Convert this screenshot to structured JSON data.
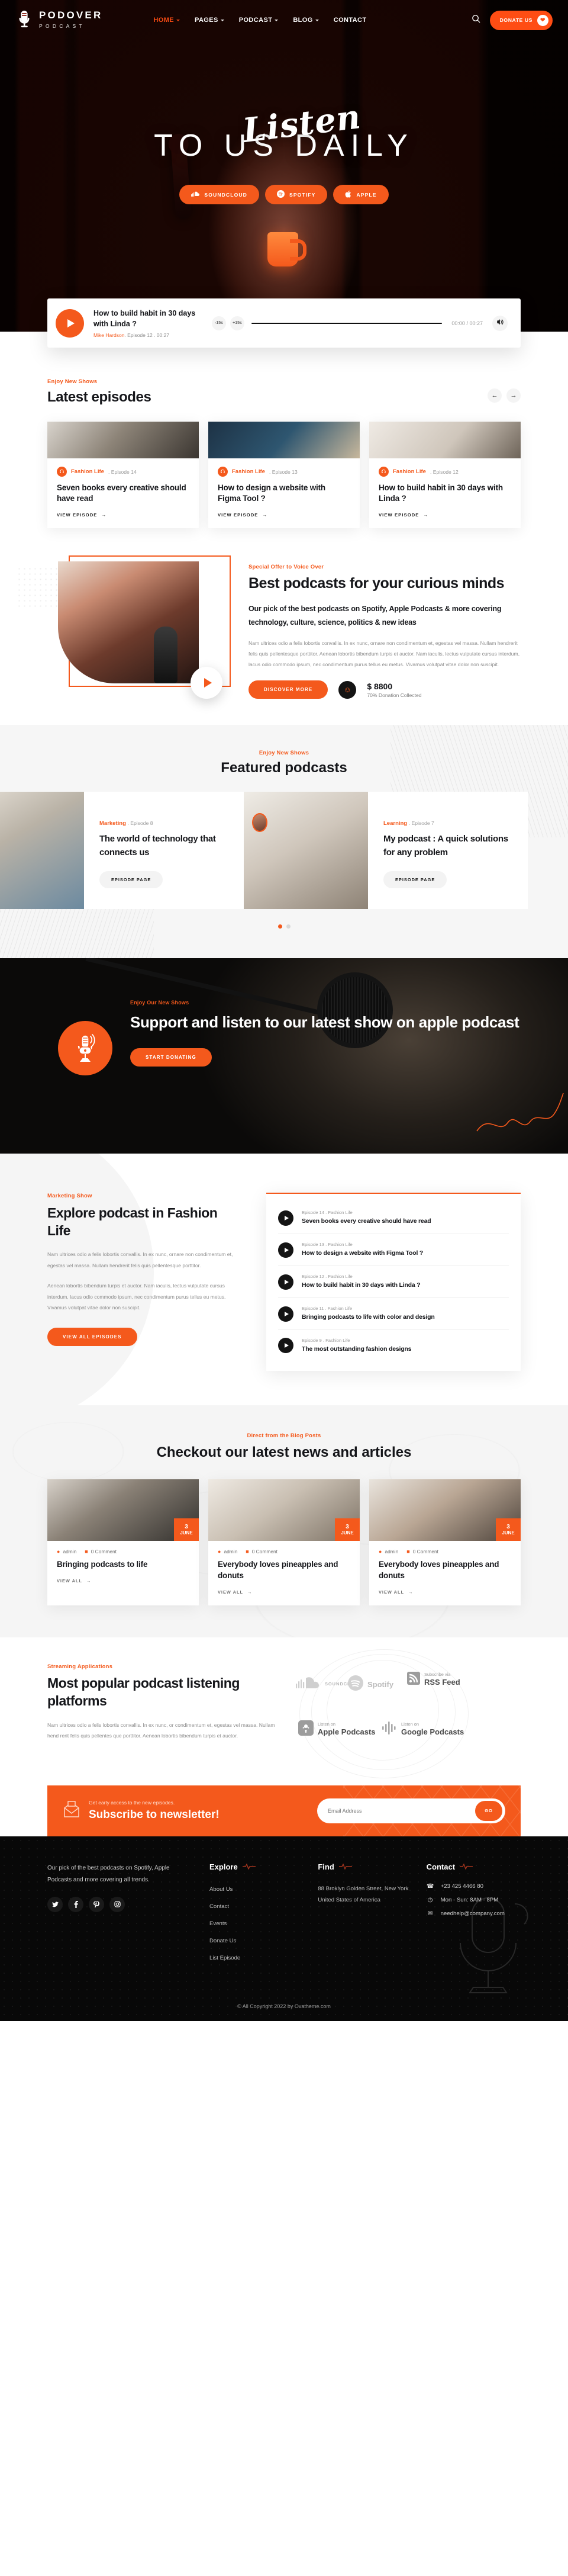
{
  "brand": {
    "name": "PODOVER",
    "tagline": "PODCAST",
    "logo_icon": "microphone-icon"
  },
  "nav": {
    "items": [
      {
        "label": "HOME",
        "has_caret": true,
        "active": true
      },
      {
        "label": "PAGES",
        "has_caret": true,
        "active": false
      },
      {
        "label": "PODCAST",
        "has_caret": true,
        "active": false
      },
      {
        "label": "BLOG",
        "has_caret": true,
        "active": false
      },
      {
        "label": "CONTACT",
        "has_caret": false,
        "active": false
      }
    ],
    "search_icon": "search-icon",
    "donate_label": "DONATE US",
    "donate_icon": "heart-icon"
  },
  "hero": {
    "script_word": "Listen",
    "headline": "TO US DAILY",
    "buttons": [
      {
        "label": "SOUNDCLOUD",
        "icon": "soundcloud-icon"
      },
      {
        "label": "SPOTIFY",
        "icon": "spotify-icon"
      },
      {
        "label": "APPLE",
        "icon": "apple-icon"
      }
    ]
  },
  "player": {
    "title": "How to build habit in 30 days with Linda ?",
    "author": "Mike Hardson",
    "meta": ". Episode 12 . 00:27",
    "back_label": "-15s",
    "forward_label": "+15s",
    "current_time": "00:00",
    "separator": "/",
    "duration": "00:27",
    "play_icon": "play-icon",
    "volume_icon": "volume-icon"
  },
  "latest": {
    "eyebrow": "Enjoy New Shows",
    "title": "Latest episodes",
    "prev_icon": "arrow-left-icon",
    "next_icon": "arrow-right-icon",
    "link_label": "VIEW EPISODE",
    "cards": [
      {
        "category": "Fashion Life",
        "episode": ". Episode 14",
        "title": "Seven books every creative should have read"
      },
      {
        "category": "Fashion Life",
        "episode": ". Episode 13",
        "title": "How to design a website with Figma Tool ?"
      },
      {
        "category": "Fashion Life",
        "episode": ". Episode 12",
        "title": "How to build habit in 30 days with Linda ?"
      }
    ]
  },
  "best": {
    "eyebrow": "Special Offer to Voice Over",
    "title": "Best podcasts for your curious minds",
    "lead": "Our pick of the best podcasts on Spotify, Apple Podcasts & more covering technology, culture, science, politics & new ideas",
    "paragraph": "Nam ultrices odio a felis lobortis convallis. In ex nunc, ornare non condimentum et, egestas vel massa. Nullam hendrerit felis quis pellentesque porttitor. Aenean lobortis bibendum turpis et auctor. Nam iaculis, lectus vulputate cursus interdum, lacus odio commodo ipsum, nec condimentum purus tellus eu metus. Vivamus volutpat vitae dolor non suscipit.",
    "cta_label": "DISCOVER MORE",
    "donation_amount": "$ 8800",
    "donation_sub": "70% Donation Collected",
    "play_icon": "play-icon",
    "donation_icon": "donation-hand-icon"
  },
  "featured": {
    "eyebrow": "Enjoy New Shows",
    "title": "Featured podcasts",
    "button_label": "EPISODE PAGE",
    "cards": [
      {
        "category": "Marketing",
        "episode": ". Episode 8",
        "title": "The world of technology that connects us"
      },
      {
        "category": "Learning",
        "episode": ". Episode 7",
        "title": "My podcast : A quick solutions for any problem"
      }
    ],
    "pager": {
      "active_index": 0,
      "count": 2
    }
  },
  "support": {
    "eyebrow": "Enjoy Our New Shows",
    "title": "Support and listen to our latest show on apple podcast",
    "cta_label": "START DONATING",
    "icon": "microphone-icon"
  },
  "explore": {
    "eyebrow": "Marketing Show",
    "title": "Explore podcast in Fashion Life",
    "paragraph1": "Nam ultrices odio a felis lobortis convallis. In ex nunc, ornare non condimentum et, egestas vel massa. Nullam hendrerit felis quis pellentesque porttitor.",
    "paragraph2": "Aenean lobortis bibendum turpis et auctor. Nam iaculis, lectus vulputate cursus interdum, lacus odio commodo ipsum, nec condimentum purus tellus eu metus. Vivamus volutpat vitae dolor non suscipit.",
    "cta_label": "VIEW ALL EPISODES",
    "episodes": [
      {
        "meta": "Episode 14 . Fashion Life",
        "title": "Seven books every creative should have read"
      },
      {
        "meta": "Episode 13 . Fashion Life",
        "title": "How to design a website with Figma Tool ?"
      },
      {
        "meta": "Episode 12 . Fashion Life",
        "title": "How to build habit in 30 days with Linda ?"
      },
      {
        "meta": "Episode 11 . Fashion Life",
        "title": "Bringing podcasts to life with color and design"
      },
      {
        "meta": "Episode 9 . Fashion Life",
        "title": "The most outstanding fashion designs"
      }
    ]
  },
  "blog": {
    "eyebrow": "Direct from the Blog Posts",
    "title": "Checkout our latest news and articles",
    "link_label": "VIEW ALL",
    "posts": [
      {
        "day": "3",
        "month": "JUNE",
        "author": "admin",
        "comments": "0 Comment",
        "title": "Bringing podcasts to life"
      },
      {
        "day": "3",
        "month": "JUNE",
        "author": "admin",
        "comments": "0 Comment",
        "title": "Everybody loves pineapples and donuts"
      },
      {
        "day": "3",
        "month": "JUNE",
        "author": "admin",
        "comments": "0 Comment",
        "title": "Everybody loves pineapples and donuts"
      }
    ]
  },
  "platforms": {
    "eyebrow": "Streaming Applications",
    "title": "Most popular podcast listening platforms",
    "paragraph": "Nam ultrices odio a felis lobortis convallis. In ex nunc, or condimentum et, egestas vel massa. Nullam hend rerit felis quis pellentes que porttitor. Aenean lobortis bibendum turpis et auctor.",
    "logos": [
      {
        "sub": "",
        "main": "SOUNDCLOUD",
        "icon": "soundcloud-icon"
      },
      {
        "sub": "",
        "main": "Spotify",
        "icon": "spotify-icon"
      },
      {
        "sub": "Subscribe via",
        "main": "RSS Feed",
        "icon": "rss-icon"
      },
      {
        "sub": "Listen on",
        "main": "Apple Podcasts",
        "icon": "apple-podcasts-icon"
      },
      {
        "sub": "Listen on",
        "main": "Google Podcasts",
        "icon": "google-podcasts-icon"
      }
    ]
  },
  "newsletter": {
    "small": "Get early access to the new episodes.",
    "title": "Subscribe to newsletter!",
    "placeholder": "Email Address",
    "value": "",
    "button_label": "GO",
    "icon": "envelope-icon"
  },
  "footer": {
    "about": "Our pick of the best podcasts on Spotify, Apple Podcasts and more covering all trends.",
    "socials": [
      {
        "name": "twitter-icon",
        "glyph": "ᵗ"
      },
      {
        "name": "facebook-icon",
        "glyph": "f"
      },
      {
        "name": "pinterest-icon",
        "glyph": "P"
      },
      {
        "name": "instagram-icon",
        "glyph": "□"
      }
    ],
    "explore": {
      "heading": "Explore",
      "items": [
        "About Us",
        "Contact",
        "Events",
        "Donate Us",
        "List Episode"
      ]
    },
    "find": {
      "heading": "Find",
      "address": "88 Broklyn Golden Street, New York United States of America"
    },
    "contact": {
      "heading": "Contact",
      "rows": [
        {
          "icon": "phone-icon",
          "text": "+23 425 4466 80"
        },
        {
          "icon": "clock-icon",
          "text": "Mon - Sun: 8AM - 8PM"
        },
        {
          "icon": "mail-icon",
          "text": "needhelp@company.com"
        }
      ]
    },
    "copyright": "© All Copyright 2022 by Ovatheme.com"
  },
  "colors": {
    "accent": "#f4591c",
    "accent_alt": "#ff4d14",
    "dark": "#080808",
    "grey_bg": "#f5f5f5"
  }
}
